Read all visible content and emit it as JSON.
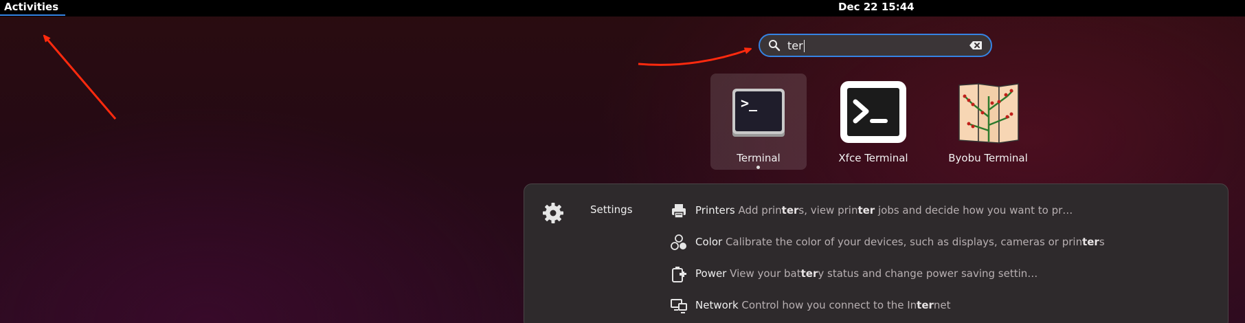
{
  "topbar": {
    "activities_label": "Activities",
    "clock": "Dec 22  15:44"
  },
  "search": {
    "value": "ter",
    "icon": "search-icon",
    "clear_icon": "backspace-clear-icon"
  },
  "apps": [
    {
      "label": "Terminal",
      "icon": "gnome-terminal-icon",
      "selected": true,
      "running": true
    },
    {
      "label": "Xfce Terminal",
      "icon": "xfce-terminal-icon",
      "selected": false
    },
    {
      "label": "Byobu Terminal",
      "icon": "byobu-terminal-icon",
      "selected": false
    }
  ],
  "settings_results": {
    "provider": {
      "label": "Settings",
      "icon": "gear-icon"
    },
    "rows": [
      {
        "title": "Printers",
        "icon": "printer-icon",
        "desc_parts": [
          "Add prin",
          "ter",
          "s, view prin",
          "ter",
          " jobs and decide how you want to pr…"
        ]
      },
      {
        "title": "Color",
        "icon": "color-icon",
        "desc_parts": [
          "Calibrate the color of your devices, such as displays, cameras or prin",
          "ter",
          "s"
        ]
      },
      {
        "title": "Power",
        "icon": "power-plug-icon",
        "desc_parts": [
          "View your bat",
          "ter",
          "y status and change power saving settin…"
        ]
      },
      {
        "title": "Network",
        "icon": "network-icon",
        "desc_parts": [
          "Control how you connect to the In",
          "ter",
          "net"
        ]
      }
    ]
  },
  "colors": {
    "accent": "#3584e4",
    "annotation_arrow": "#ff2a0e",
    "topbar": "#000000"
  }
}
